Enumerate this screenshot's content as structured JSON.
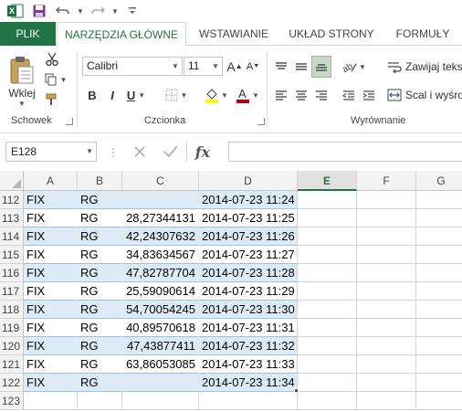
{
  "qat": {
    "icons": [
      "excel-logo-icon",
      "save-icon",
      "undo-icon",
      "redo-icon",
      "customize-qat-icon"
    ]
  },
  "tabs": {
    "file": "PLIK",
    "home": "NARZĘDZIA GŁÓWNE",
    "insert": "WSTAWIANIE",
    "page_layout": "UKŁAD STRONY",
    "formulas": "FORMUŁY"
  },
  "ribbon": {
    "clipboard": {
      "paste_label": "Wklej",
      "group_label": "Schowek"
    },
    "font": {
      "font_name": "Calibri",
      "font_size": "11",
      "bold": "B",
      "italic": "I",
      "underline": "U",
      "grow": "A",
      "shrink": "A",
      "group_label": "Czcionka",
      "fill_color": "#ffff00",
      "font_color": "#c00000"
    },
    "alignment": {
      "wrap_text": "Zawijaj teks",
      "merge_center": "Scal i wyśro",
      "group_label": "Wyrównanie"
    }
  },
  "formula_bar": {
    "name_box": "E128",
    "fx": "fx",
    "value": ""
  },
  "grid": {
    "accent": "#217346",
    "band_color": "#ddebf7",
    "columns": [
      "A",
      "B",
      "C",
      "D",
      "E",
      "F",
      "G"
    ],
    "selected_column": "E",
    "rows": [
      {
        "num": "112",
        "a": "FIX",
        "b": "RG",
        "c": "",
        "d": "2014-07-23 11:24"
      },
      {
        "num": "113",
        "a": "FIX",
        "b": "RG",
        "c": "28,27344131",
        "d": "2014-07-23 11:25"
      },
      {
        "num": "114",
        "a": "FIX",
        "b": "RG",
        "c": "42,24307632",
        "d": "2014-07-23 11:26"
      },
      {
        "num": "115",
        "a": "FIX",
        "b": "RG",
        "c": "34,83634567",
        "d": "2014-07-23 11:27"
      },
      {
        "num": "116",
        "a": "FIX",
        "b": "RG",
        "c": "47,82787704",
        "d": "2014-07-23 11:28"
      },
      {
        "num": "117",
        "a": "FIX",
        "b": "RG",
        "c": "25,59090614",
        "d": "2014-07-23 11:29"
      },
      {
        "num": "118",
        "a": "FIX",
        "b": "RG",
        "c": "54,70054245",
        "d": "2014-07-23 11:30"
      },
      {
        "num": "119",
        "a": "FIX",
        "b": "RG",
        "c": "40,89570618",
        "d": "2014-07-23 11:31"
      },
      {
        "num": "120",
        "a": "FIX",
        "b": "RG",
        "c": "47,43877411",
        "d": "2014-07-23 11:32"
      },
      {
        "num": "121",
        "a": "FIX",
        "b": "RG",
        "c": "63,86053085",
        "d": "2014-07-23 11:33"
      },
      {
        "num": "122",
        "a": "FIX",
        "b": "RG",
        "c": "",
        "d": "2014-07-23 11:34"
      },
      {
        "num": "123",
        "a": "",
        "b": "",
        "c": "",
        "d": ""
      }
    ]
  }
}
